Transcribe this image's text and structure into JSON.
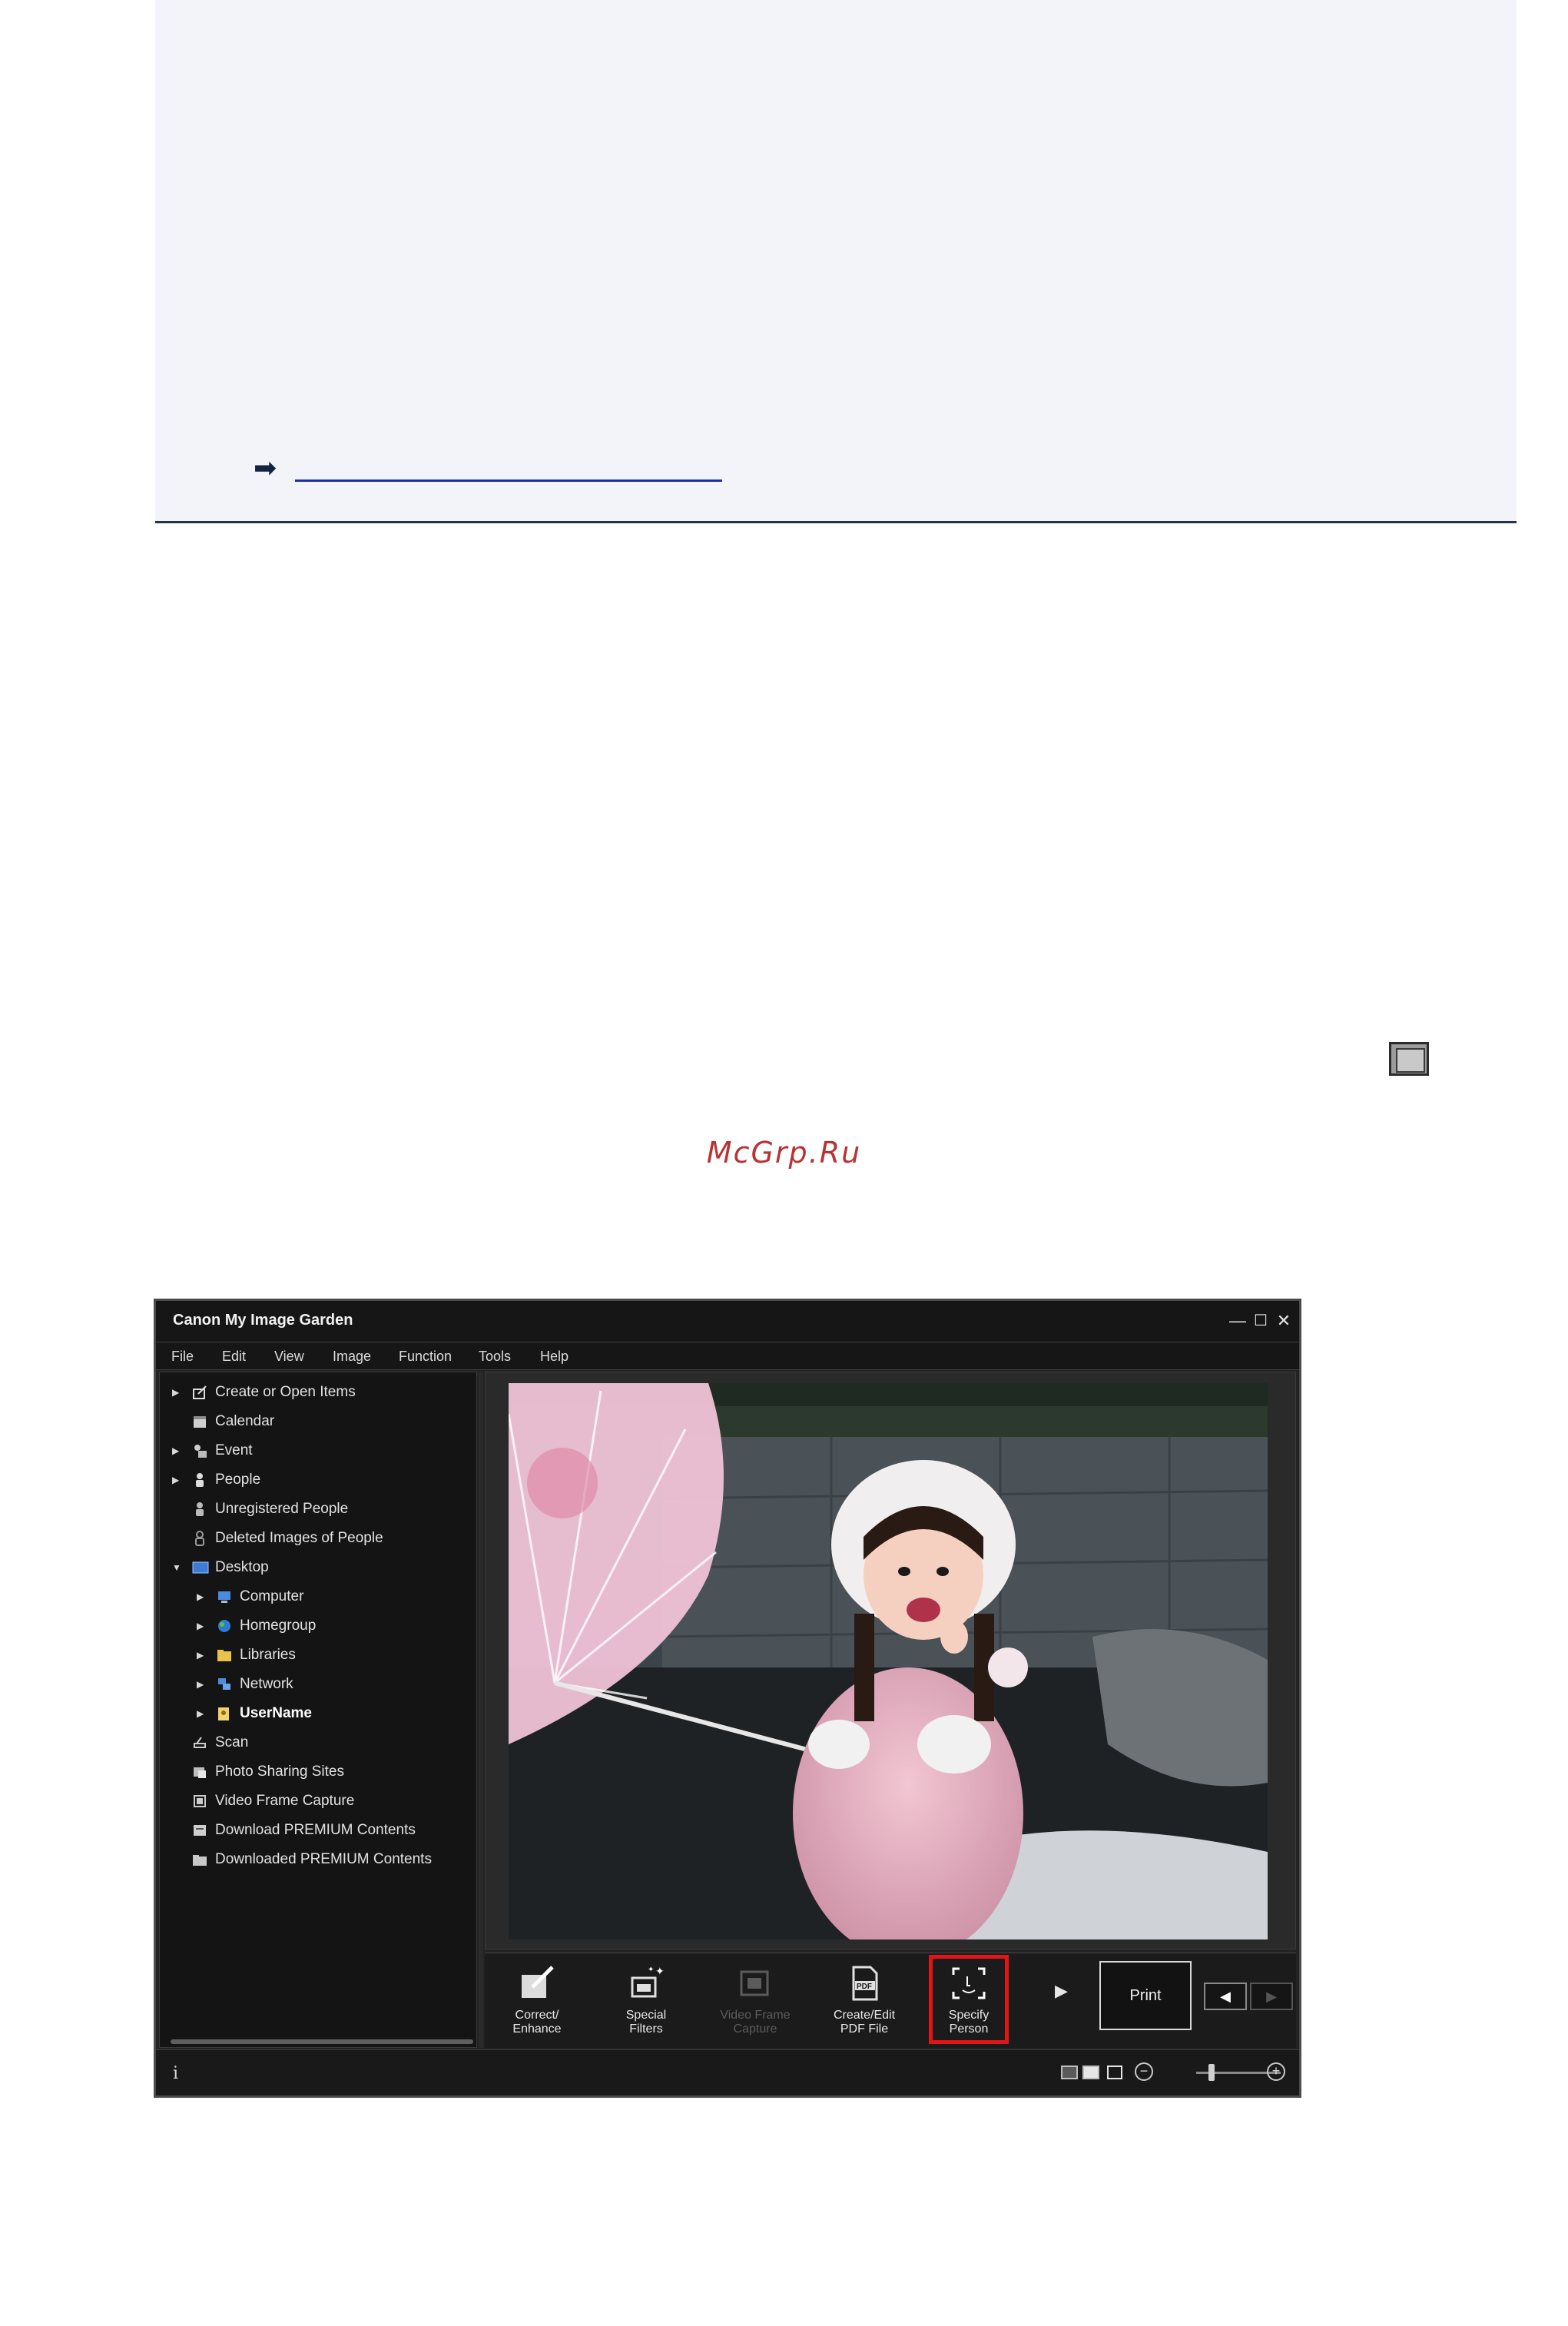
{
  "document": {
    "link_arrow": "➡",
    "watermark": "McGrp.Ru"
  },
  "app": {
    "title": "Canon My Image Garden",
    "window_controls": {
      "minimize": "—",
      "maximize": "☐",
      "close": "✕"
    },
    "menu": [
      "File",
      "Edit",
      "View",
      "Image",
      "Function",
      "Tools",
      "Help"
    ],
    "sidebar": {
      "items": [
        {
          "label": "Create or Open Items",
          "icon": "create-icon",
          "expander": "▶",
          "level": 0
        },
        {
          "label": "Calendar",
          "icon": "calendar-icon",
          "expander": "",
          "level": 0
        },
        {
          "label": "Event",
          "icon": "event-icon",
          "expander": "▶",
          "level": 0
        },
        {
          "label": "People",
          "icon": "person-icon",
          "expander": "▶",
          "level": 0
        },
        {
          "label": "Unregistered People",
          "icon": "unregistered-person-icon",
          "expander": "",
          "level": 0
        },
        {
          "label": "Deleted Images of People",
          "icon": "deleted-person-icon",
          "expander": "",
          "level": 0
        },
        {
          "label": "Desktop",
          "icon": "desktop-icon",
          "expander": "▼",
          "level": 0
        },
        {
          "label": "Computer",
          "icon": "computer-icon",
          "expander": "▶",
          "level": 1
        },
        {
          "label": "Homegroup",
          "icon": "homegroup-icon",
          "expander": "▶",
          "level": 1
        },
        {
          "label": "Libraries",
          "icon": "libraries-icon",
          "expander": "▶",
          "level": 1
        },
        {
          "label": "Network",
          "icon": "network-icon",
          "expander": "▶",
          "level": 1
        },
        {
          "label": "UserName",
          "icon": "user-folder-icon",
          "expander": "▶",
          "level": 1,
          "bold": true
        },
        {
          "label": "Scan",
          "icon": "scan-icon",
          "expander": "",
          "level": 0
        },
        {
          "label": "Photo Sharing Sites",
          "icon": "photo-sharing-icon",
          "expander": "",
          "level": 0
        },
        {
          "label": "Video Frame Capture",
          "icon": "video-frame-icon",
          "expander": "",
          "level": 0
        },
        {
          "label": "Download PREMIUM Contents",
          "icon": "download-icon",
          "expander": "",
          "level": 0
        },
        {
          "label": "Downloaded PREMIUM Contents",
          "icon": "folder-icon",
          "expander": "",
          "level": 0
        }
      ]
    },
    "toolbar": {
      "tools": [
        {
          "line1": "Correct/",
          "line2": "Enhance",
          "icon": "correct-enhance-icon",
          "enabled": true
        },
        {
          "line1": "Special",
          "line2": "Filters",
          "icon": "special-filters-icon",
          "enabled": true
        },
        {
          "line1": "Video Frame",
          "line2": "Capture",
          "icon": "video-frame-capture-icon",
          "enabled": false
        },
        {
          "line1": "Create/Edit",
          "line2": "PDF File",
          "icon": "pdf-icon",
          "enabled": true
        },
        {
          "line1": "Specify",
          "line2": "Person",
          "icon": "specify-person-icon",
          "enabled": true,
          "highlighted": true
        }
      ],
      "more_arrow": "▶",
      "print_label": "Print",
      "prev_arrow": "◀",
      "next_arrow": "▶"
    },
    "statusbar": {
      "info": "i",
      "zoom_out": "−",
      "zoom_in": "+"
    },
    "colors": {
      "highlight": "#e21414",
      "link": "#1c2fa8",
      "watermark": "#b73434"
    }
  }
}
